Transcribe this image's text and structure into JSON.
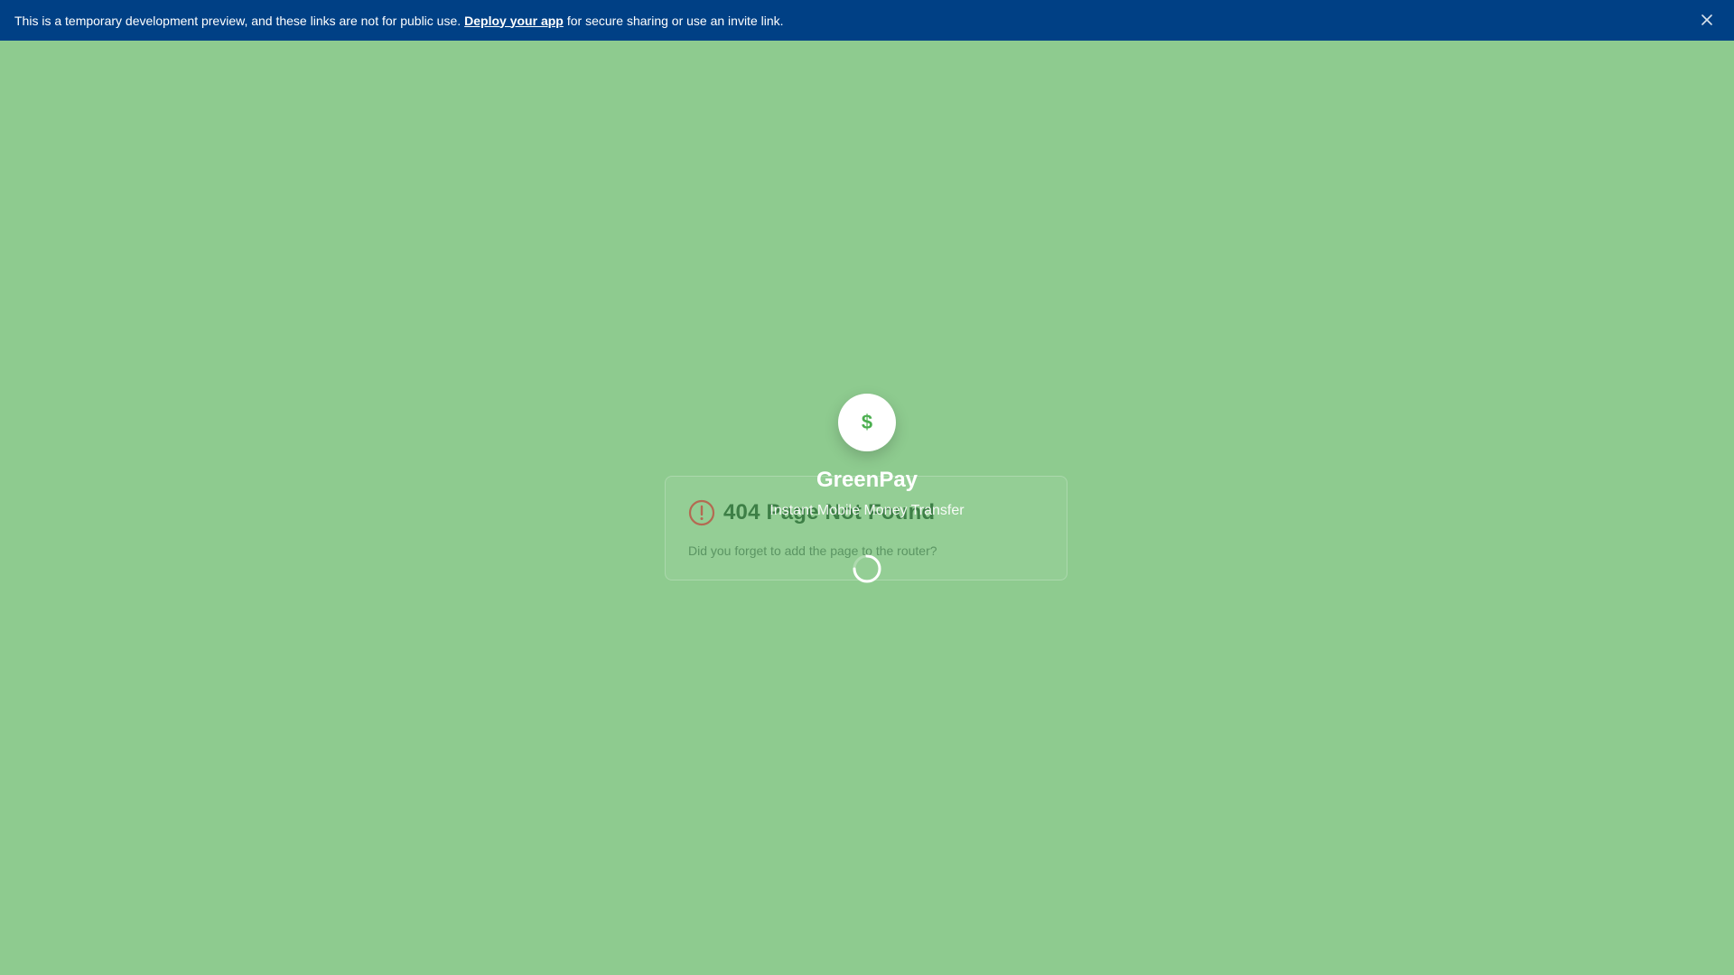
{
  "banner": {
    "text_before": "This is a temporary development preview, and these links are not for public use.",
    "link_label": "Deploy your app",
    "text_after": "for secure sharing or use an invite link.",
    "close_icon": "close-icon"
  },
  "error_card": {
    "title": "404 Page Not Found",
    "message": "Did you forget to add the page to the router?",
    "icon": "alert-circle-icon"
  },
  "splash": {
    "logo_symbol": "$",
    "app_name": "GreenPay",
    "tagline": "Instant Mobile Money Transfer",
    "loading_icon": "spinner-icon"
  },
  "colors": {
    "background": "#8ecb8f",
    "banner": "#004085",
    "accent": "#4caf50",
    "error_icon": "#b46a52"
  }
}
